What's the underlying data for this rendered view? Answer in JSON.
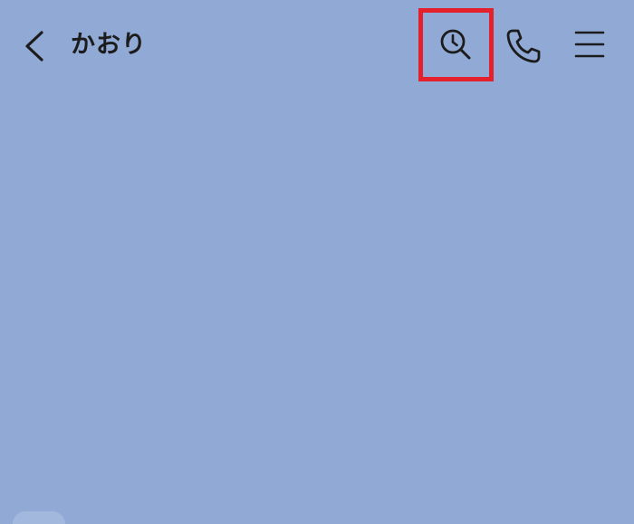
{
  "header": {
    "title": "かおり",
    "back_icon": "chevron-left-icon",
    "history_search_icon": "clock-search-icon",
    "call_icon": "phone-icon",
    "menu_icon": "hamburger-menu-icon",
    "highlight_color": "#e3202c"
  },
  "theme": {
    "background": "#91aad5",
    "text_color": "#1c1c1c"
  }
}
